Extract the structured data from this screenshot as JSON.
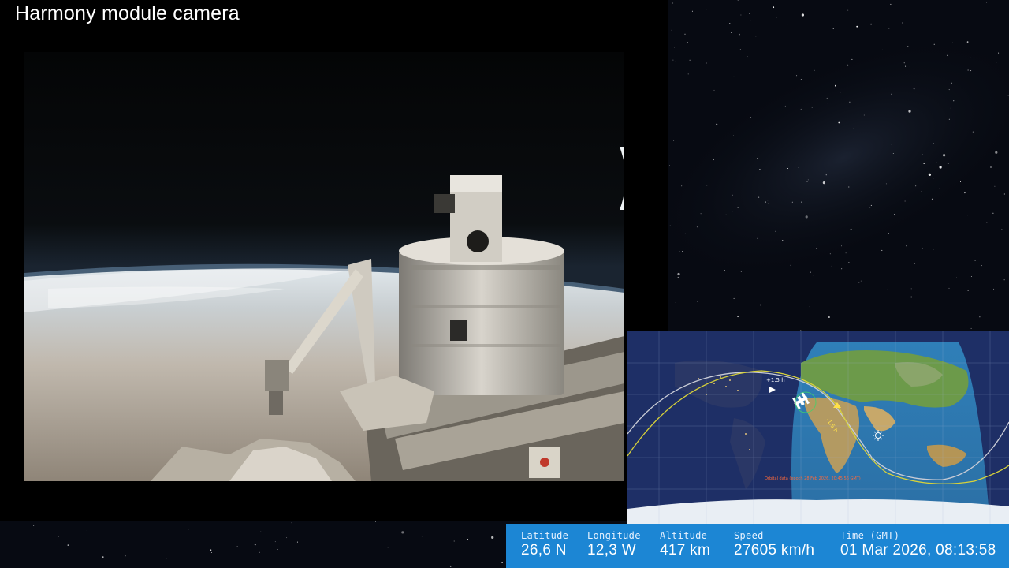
{
  "camera": {
    "title": "Harmony module camera"
  },
  "map": {
    "footer_note": "Orbital data (epoch 28 Feb 2026, 20:45:56 GMT)",
    "orbit_markers": [
      "+1.5 h",
      "-1.5 h"
    ],
    "station_icon": "station-icon",
    "sun_icon": "sun-icon"
  },
  "telemetry": {
    "latitude_label": "Latitude",
    "latitude_value": "26,6 N",
    "longitude_label": "Longitude",
    "longitude_value": "12,3 W",
    "altitude_label": "Altitude",
    "altitude_value": "417 km",
    "speed_label": "Speed",
    "speed_value": "27605 km/h",
    "time_label": "Time (GMT)",
    "time_value": "01 Mar 2026, 08:13:58"
  },
  "colors": {
    "telemetry_bg": "#1c86d4",
    "map_night": "#1e2f66",
    "map_day_ocean": "#2f7fb8",
    "orbit_current": "#d8d23a",
    "orbit_next": "#c9ccd6"
  }
}
